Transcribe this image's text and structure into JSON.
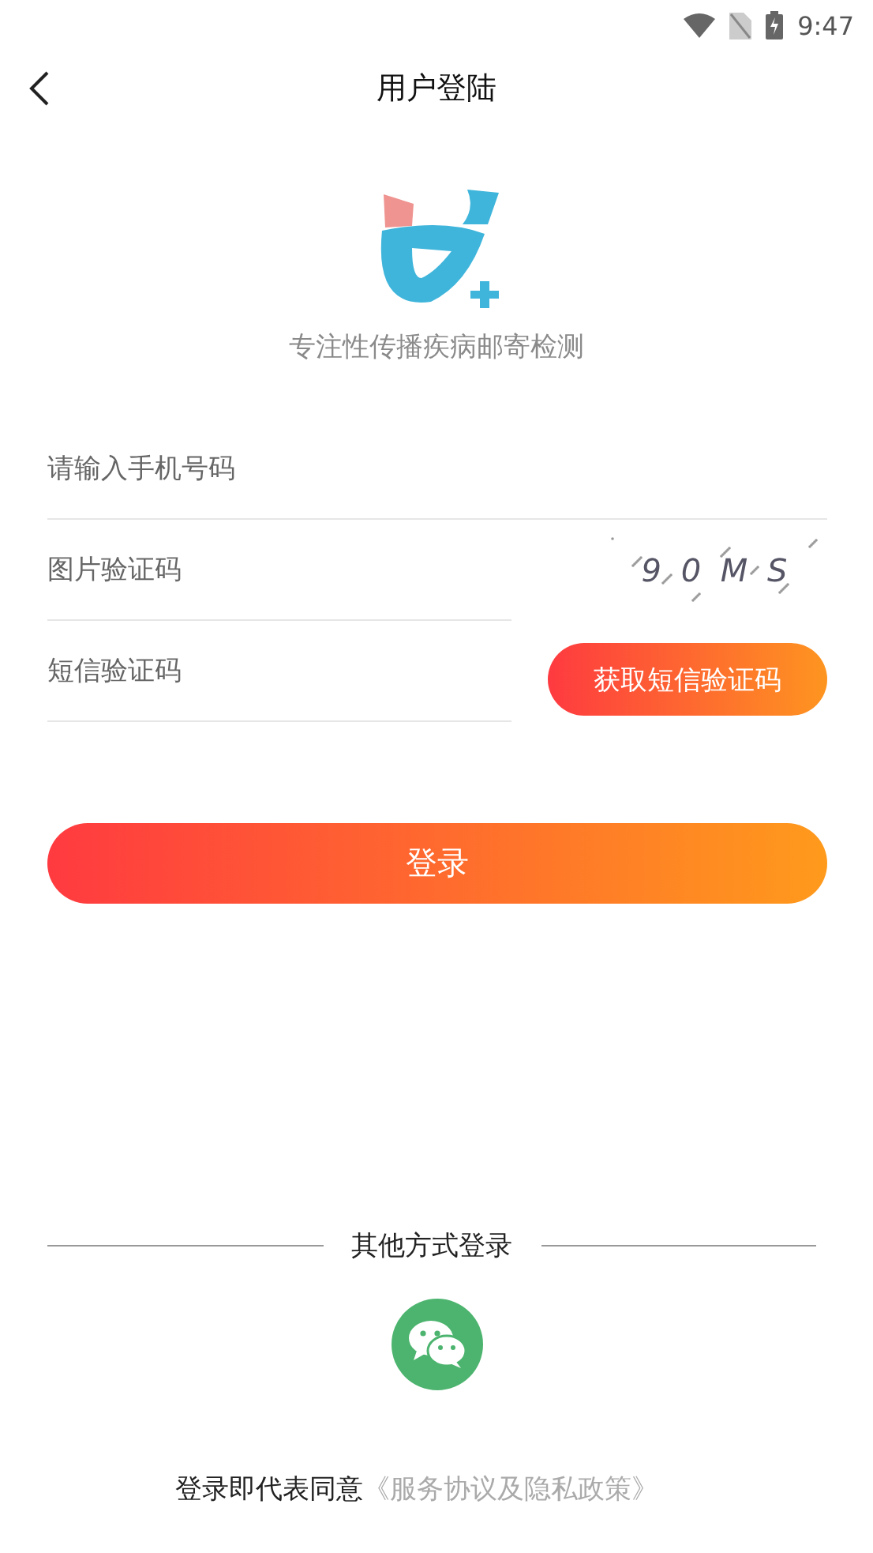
{
  "status_bar": {
    "time": "9:47"
  },
  "header": {
    "title": "用户登陆"
  },
  "slogan": "专注性传播疾病邮寄检测",
  "fields": [
    {
      "kind": "plain",
      "placeholder": "请输入手机号码"
    },
    {
      "kind": "captcha",
      "placeholder": "图片验证码",
      "captcha": "9 0 M S"
    },
    {
      "kind": "sms",
      "placeholder": "短信验证码",
      "button": "获取短信验证码"
    }
  ],
  "login_button": "登录",
  "other_login": {
    "label": "其他方式登录"
  },
  "agreement": {
    "text": "登录即代表同意",
    "link": "《服务协议及隐私政策》"
  }
}
